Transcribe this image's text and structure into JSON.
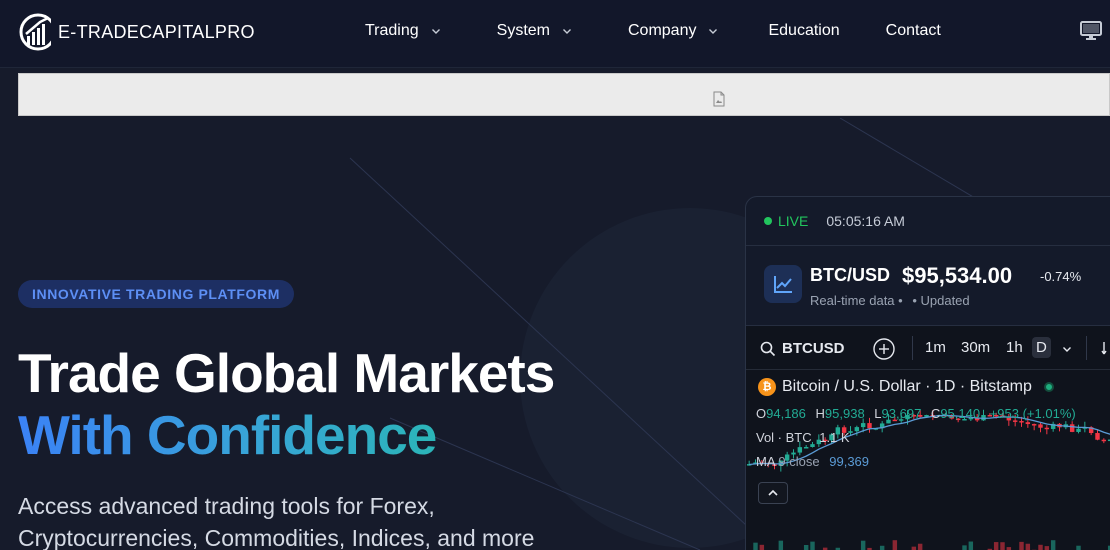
{
  "nav": {
    "logo_text": "E-TRADECAPITALPRO",
    "links": [
      {
        "label": "Trading",
        "dropdown": true
      },
      {
        "label": "System",
        "dropdown": true
      },
      {
        "label": "Company",
        "dropdown": true
      },
      {
        "label": "Education",
        "dropdown": false
      },
      {
        "label": "Contact",
        "dropdown": false
      }
    ],
    "icons": {
      "monitor": "monitor-icon"
    }
  },
  "ad": {
    "icon": "broken-image-icon"
  },
  "hero": {
    "badge": "INNOVATIVE TRADING PLATFORM",
    "title_line1": "Trade Global Markets",
    "title_line2": "With Confidence",
    "subtitle_line1": "Access advanced trading tools for Forex,",
    "subtitle_line2": "Cryptocurrencies, Commodities, Indices, and more"
  },
  "widget": {
    "live_label": "LIVE",
    "time": "05:05:16 AM",
    "pair": "BTC/USD",
    "price": "$95,534.00",
    "change": "-0.74%",
    "realtime": "Real-time data •",
    "updated": "• Updated"
  },
  "tv": {
    "symbol": "BTCUSD",
    "timeframes": [
      "1m",
      "30m",
      "1h",
      "D"
    ],
    "caption": "Bitcoin / U.S. Dollar · 1D · Bitstamp",
    "ohlc": {
      "o": "94,186",
      "h": "95,938",
      "l": "93,697",
      "c": "95,140",
      "chg": "+953 (+1.01%)"
    },
    "vol_label": "Vol · BTC",
    "vol_value": "1.1 K",
    "ma_label": "MA",
    "ma_sub": "9 close",
    "ma_value": "99,369"
  },
  "colors": {
    "bg": "#161b2b",
    "accent_blue": "#3b82f6",
    "accent_teal": "#2bb5b8",
    "up": "#22ab94",
    "down": "#f23645",
    "live": "#22c55e"
  }
}
